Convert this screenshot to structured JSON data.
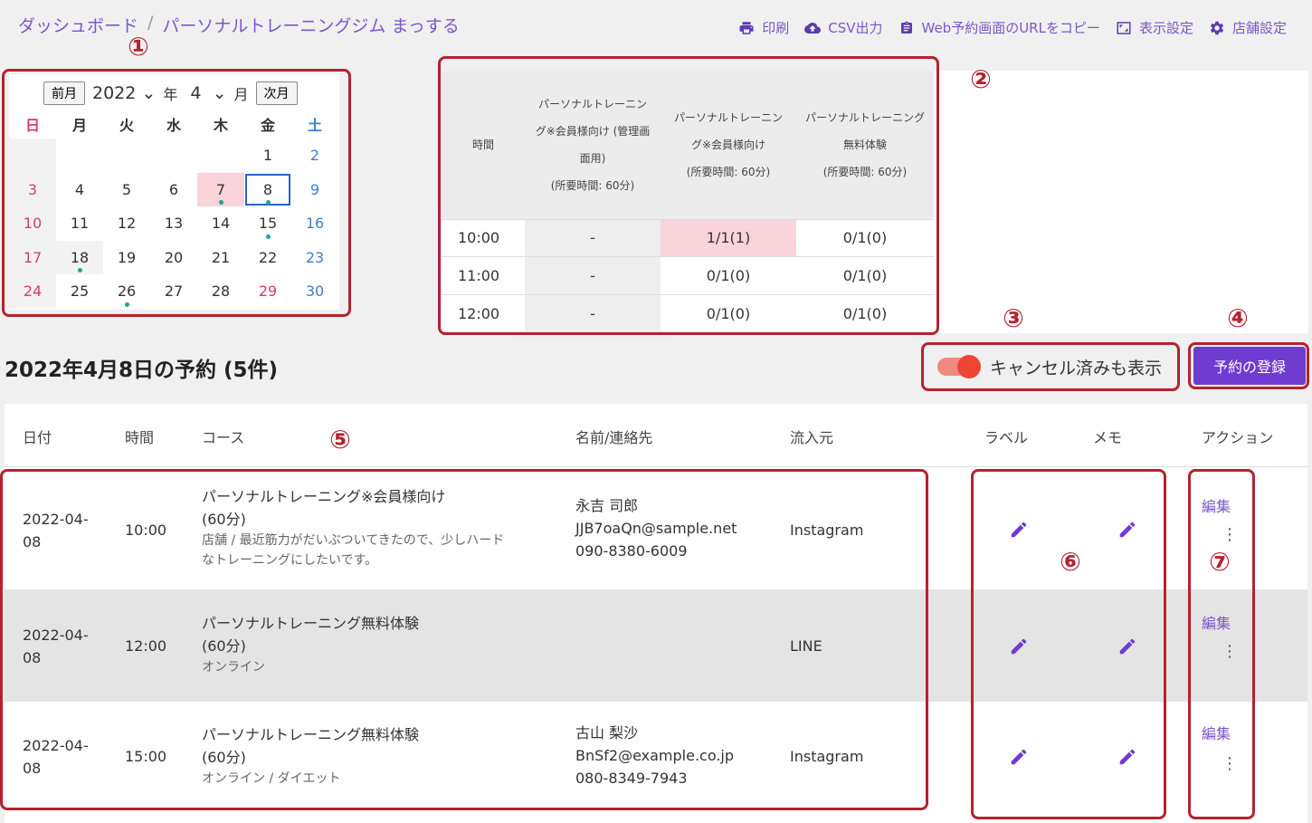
{
  "breadcrumb": {
    "home": "ダッシュボード",
    "separator": "/",
    "current": "パーソナルトレーニングジム まっする"
  },
  "toolbar": [
    {
      "icon": "printer-icon",
      "label": "印刷"
    },
    {
      "icon": "cloud-upload-icon",
      "label": "CSV出力"
    },
    {
      "icon": "clipboard-icon",
      "label": "Web予約画面のURLをコピー"
    },
    {
      "icon": "fullscreen-icon",
      "label": "表示設定"
    },
    {
      "icon": "gear-icon",
      "label": "店舗設定"
    }
  ],
  "calendar": {
    "prev_label": "前月",
    "next_label": "次月",
    "year": "2022",
    "year_suffix": "年",
    "month": "4",
    "month_suffix": "月",
    "weekdays": [
      "日",
      "月",
      "火",
      "水",
      "木",
      "金",
      "土"
    ],
    "days": [
      "",
      "",
      "",
      "",
      "",
      "1",
      "2",
      "3",
      "4",
      "5",
      "6",
      "7",
      "8",
      "9",
      "10",
      "11",
      "12",
      "13",
      "14",
      "15",
      "16",
      "17",
      "18",
      "19",
      "20",
      "21",
      "22",
      "23",
      "24",
      "25",
      "26",
      "27",
      "28",
      "29",
      "30"
    ],
    "selected_day": "8",
    "highlighted_day": "7",
    "holiday_days": [
      "29"
    ],
    "dotted_days": [
      "7",
      "8",
      "15",
      "18",
      "26"
    ]
  },
  "slots": {
    "headers": [
      "時間",
      "パーソナルトレーニング※会員様向け (管理画面用)",
      "パーソナルトレーニング※会員様向け",
      "パーソナルトレーニング無料体験"
    ],
    "duration": "(所要時間: 60分)",
    "rows": [
      {
        "time": "10:00",
        "c1": "-",
        "c2": "1/1(1)",
        "c3": "0/1(0)"
      },
      {
        "time": "11:00",
        "c1": "-",
        "c2": "0/1(0)",
        "c3": "0/1(0)"
      },
      {
        "time": "12:00",
        "c1": "-",
        "c2": "0/1(0)",
        "c3": "0/1(0)"
      }
    ]
  },
  "annotations": [
    "①",
    "②",
    "③",
    "④",
    "⑤",
    "⑥",
    "⑦"
  ],
  "section_title": "2022年4月8日の予約 (5件)",
  "show_cancelled_label": "キャンセル済みも表示",
  "register_button": "予約の登録",
  "table": {
    "headers": [
      "日付",
      "時間",
      "コース",
      "名前/連絡先",
      "流入元",
      "ラベル",
      "メモ",
      "アクション"
    ],
    "rows": [
      {
        "date1": "2022-04-",
        "date2": "08",
        "time": "10:00",
        "course": "パーソナルトレーニング※会員様向け",
        "duration": "(60分)",
        "note1": "店舗 / 最近筋力がだいぶついてきたので、少しハード",
        "note2": "なトレーニングにしたいです。",
        "name": "永吉 司郎",
        "email": "JJB7oaQn@sample.net",
        "phone": "090-8380-6009",
        "source": "Instagram",
        "edit": "編集"
      },
      {
        "date1": "2022-04-",
        "date2": "08",
        "time": "12:00",
        "course": "パーソナルトレーニング無料体験",
        "duration": "(60分)",
        "note1": "オンライン",
        "note2": "",
        "name": "",
        "email": "",
        "phone": "",
        "source": "LINE",
        "edit": "編集"
      },
      {
        "date1": "2022-04-",
        "date2": "08",
        "time": "15:00",
        "course": "パーソナルトレーニング無料体験",
        "duration": "(60分)",
        "note1": "オンライン / ダイエット",
        "note2": "",
        "name": "古山 梨沙",
        "email": "BnSf2@example.co.jp",
        "phone": "080-8349-7943",
        "source": "Instagram",
        "edit": "編集"
      }
    ]
  }
}
